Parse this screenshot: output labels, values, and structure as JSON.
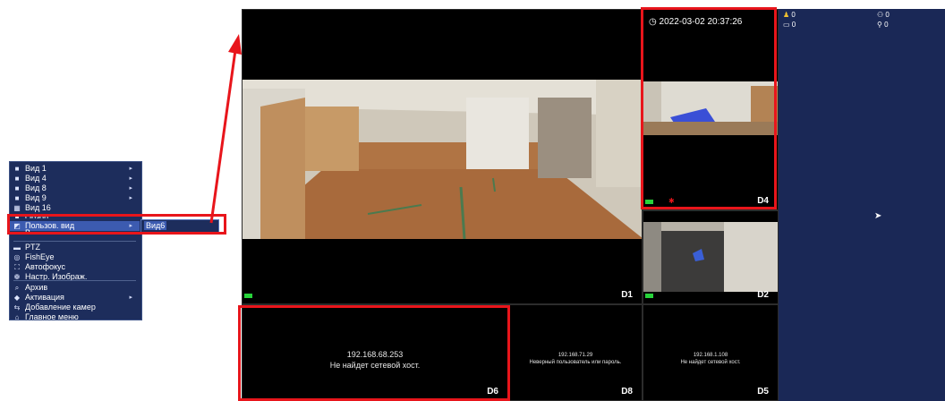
{
  "menu": {
    "items": [
      {
        "label": "Вид 1",
        "icon": "■",
        "arrow": "▸"
      },
      {
        "label": "Вид 4",
        "icon": "■",
        "arrow": "▸"
      },
      {
        "label": "Вид 8",
        "icon": "■",
        "arrow": "▸"
      },
      {
        "label": "Вид 9",
        "icon": "■",
        "arrow": "▸"
      },
      {
        "label": "Вид 16",
        "icon": "▦",
        "arrow": ""
      },
      {
        "label": "Обзор",
        "icon": "■",
        "arrow": ""
      },
      {
        "label": "Пользов. вид",
        "icon": "◩",
        "arrow": "▸"
      },
      {
        "label": "В...",
        "icon": "·",
        "arrow": ""
      },
      {
        "label": "PTZ",
        "icon": "▬",
        "arrow": ""
      },
      {
        "label": "FishEye",
        "icon": "◎",
        "arrow": ""
      },
      {
        "label": "Автофокус",
        "icon": "⛶",
        "arrow": ""
      },
      {
        "label": "Настр. Изображ.",
        "icon": "❁",
        "arrow": ""
      },
      {
        "label": "Архив",
        "icon": "⌕",
        "arrow": ""
      },
      {
        "label": "Активация",
        "icon": "◆",
        "arrow": "▸"
      },
      {
        "label": "Добавление камер",
        "icon": "⇆",
        "arrow": ""
      },
      {
        "label": "Главное меню",
        "icon": "⌂",
        "arrow": ""
      }
    ],
    "submenu_item": "Вид6"
  },
  "wall": {
    "timestamp": "2022-03-02 20:37:26",
    "channels": {
      "d1": "D1",
      "d2": "D2",
      "d4": "D4",
      "d5": "D5",
      "d6": "D6",
      "d8": "D8"
    },
    "d6": {
      "ip": "192.168.68.253",
      "message": "Не найдет сетевой хост."
    },
    "d8": {
      "ip": "192.168.71.29",
      "message": "Неверный пользователь или пароль."
    },
    "d5": {
      "ip": "192.168.1.108",
      "message": "Не найдет сетевой хост."
    }
  },
  "stats": {
    "person": "0",
    "car": "0",
    "nonmotor": "0",
    "bike": "0"
  },
  "colors": {
    "menu_bg": "#1d2d5c",
    "menu_selected": "#3c5bb0",
    "panel_bg": "#1a2856",
    "highlight": "#e8151b",
    "rec_indicator": "#27d33a"
  }
}
